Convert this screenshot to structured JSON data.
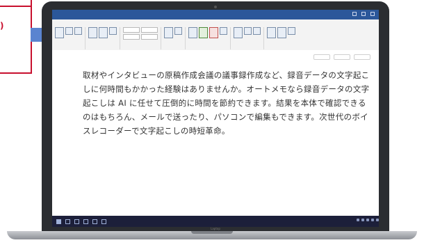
{
  "callout": {
    "text": ")"
  },
  "laptop": {
    "brand": "Laptop"
  },
  "window": {
    "title": "",
    "menu": [
      "",
      "",
      "",
      "",
      "",
      "",
      ""
    ]
  },
  "document": {
    "paragraph": "取材やインタビューの原稿作成会議の議事録作成など、録音データの文字起こしに何時間もかかった経験はありませんか。オートメモなら録音データの文字起こしは AI に任せて圧倒的に時間を節約できます。結果を本体で確認できるのはもちろん、メールで送ったり、パソコンで編集もできます。次世代のボイスレコーダーで文字起こしの時短革命。"
  },
  "colors": {
    "callout_border": "#c8102e",
    "accent_blue": "#5a84d0",
    "titlebar": "#2b579a",
    "taskbar": "#1c1f3a"
  }
}
